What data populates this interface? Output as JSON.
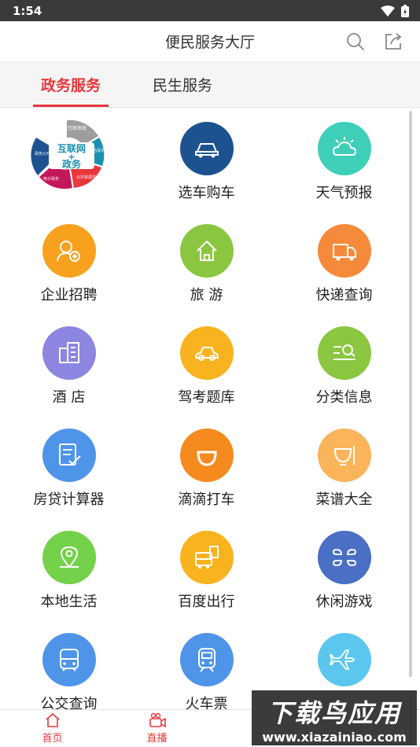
{
  "status": {
    "time": "1:54"
  },
  "header": {
    "title": "便民服务大厅",
    "search_icon": "search-icon",
    "share_icon": "share-icon"
  },
  "tabs": [
    {
      "label": "政务服务",
      "active": true
    },
    {
      "label": "民生服务",
      "active": false
    }
  ],
  "logo": {
    "main_lines": [
      "互联网",
      "+",
      "政务"
    ],
    "petals": [
      "行政审批",
      "综合民诉求",
      "公共资源交易",
      "电子政务",
      "政务公开"
    ]
  },
  "services": [
    {
      "label": "选车购车",
      "icon": "car-icon",
      "color": "#1d5290"
    },
    {
      "label": "天气预报",
      "icon": "weather-icon",
      "color": "#3fcfb8"
    },
    {
      "label": "企业招聘",
      "icon": "recruit-icon",
      "color": "#f7a11e"
    },
    {
      "label": "旅 游",
      "icon": "travel-icon",
      "color": "#8bc640"
    },
    {
      "label": "快递查询",
      "icon": "express-icon",
      "color": "#f58a3b"
    },
    {
      "label": "酒 店",
      "icon": "hotel-icon",
      "color": "#8c86e0"
    },
    {
      "label": "驾考题库",
      "icon": "driving-test-icon",
      "color": "#f9b31f"
    },
    {
      "label": "分类信息",
      "icon": "category-icon",
      "color": "#8bc640"
    },
    {
      "label": "房贷计算器",
      "icon": "loan-calculator-icon",
      "color": "#4e95ea"
    },
    {
      "label": "滴滴打车",
      "icon": "didi-icon",
      "color": "#f58a1f"
    },
    {
      "label": "菜谱大全",
      "icon": "recipe-icon",
      "color": "#fab45a"
    },
    {
      "label": "本地生活",
      "icon": "location-icon",
      "color": "#74d14a"
    },
    {
      "label": "百度出行",
      "icon": "bus-icon",
      "color": "#f9b31f"
    },
    {
      "label": "休闲游戏",
      "icon": "game-icon",
      "color": "#4a6fc4"
    },
    {
      "label": "公交查询",
      "icon": "bus-query-icon",
      "color": "#4e95ea"
    },
    {
      "label": "火车票",
      "icon": "train-icon",
      "color": "#4e95ea"
    },
    {
      "label": "机票",
      "icon": "plane-icon",
      "color": "#5bc7ee"
    }
  ],
  "bottom_tabs": [
    {
      "label": "首页",
      "icon": "home-icon"
    },
    {
      "label": "直播",
      "icon": "video-icon"
    }
  ],
  "watermark": {
    "title": "下载鸟应用",
    "url": "www.xiazainiao.com"
  },
  "colors": {
    "accent": "#e8383d",
    "status_bar": "#3a3a3a"
  }
}
